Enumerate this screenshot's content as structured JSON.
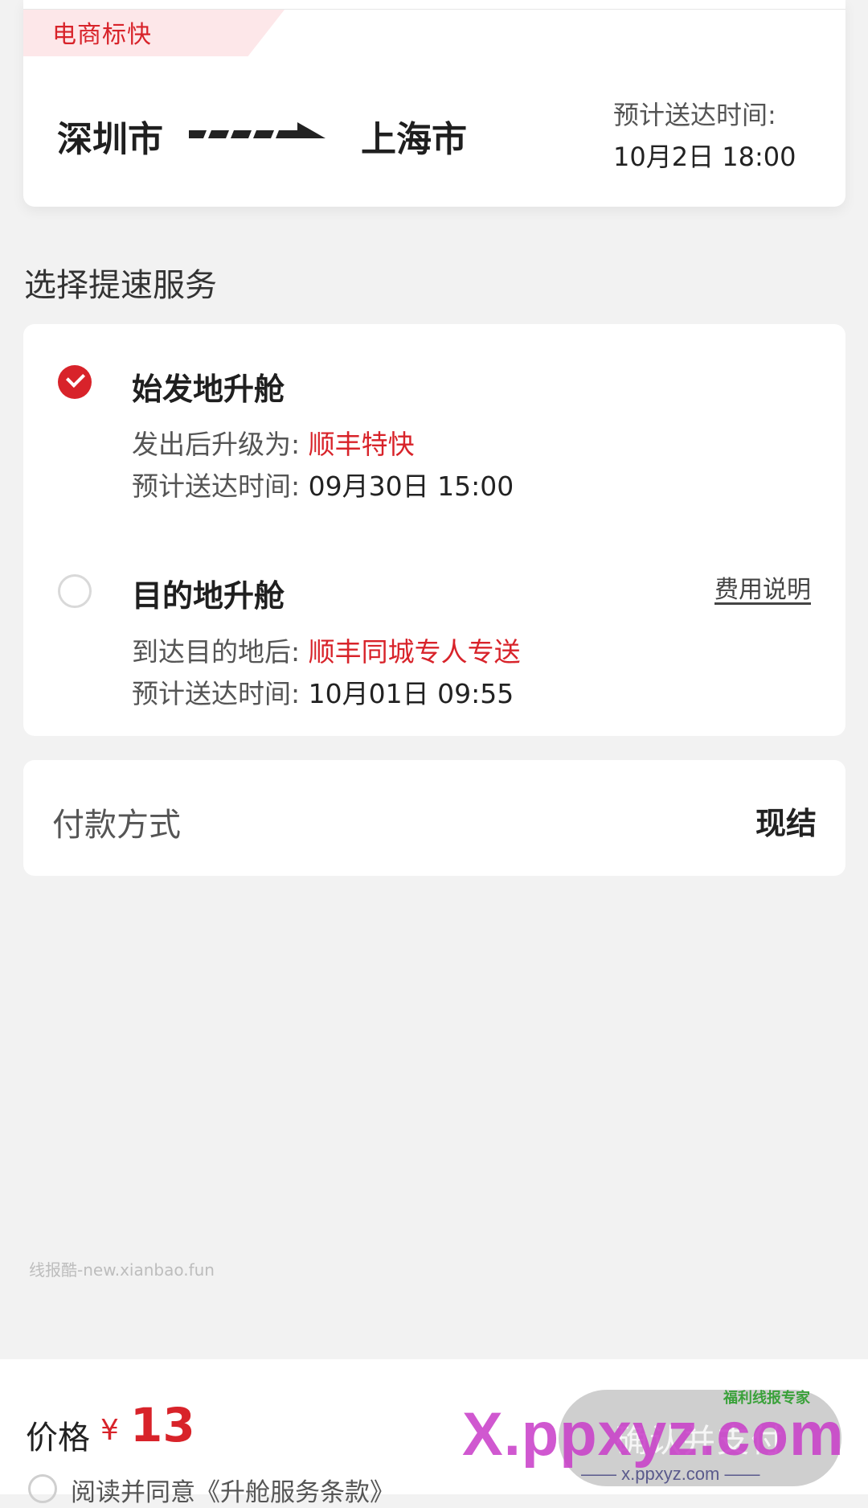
{
  "route": {
    "service_tag": "电商标快",
    "origin": "深圳市",
    "destination": "上海市",
    "eta_label": "预计送达时间:",
    "eta_value": "10月2日 18:00"
  },
  "section_title": "选择提速服务",
  "options": [
    {
      "title": "始发地升舱",
      "selected": true,
      "row1_label": "发出后升级为:",
      "row1_value": "顺丰特快",
      "row2_label": "预计送达时间:",
      "row2_value": "09月30日 15:00"
    },
    {
      "title": "目的地升舱",
      "selected": false,
      "link": "费用说明",
      "row1_label": "到达目的地后:",
      "row1_value": "顺丰同城专人专送",
      "row2_label": "预计送达时间:",
      "row2_value": "10月01日 09:55"
    }
  ],
  "payment": {
    "label": "付款方式",
    "value": "现结"
  },
  "watermark_text": "线报酷-new.xianbao.fun",
  "footer": {
    "price_label": "价格",
    "currency": "¥",
    "price": "13",
    "agreement_text": "阅读并同意《升舱服务条款》",
    "confirm_label": "确认并支付"
  },
  "site_watermark": {
    "brand": "X.ppxyz.com",
    "url": "—— x.ppxyz.com ——",
    "badge": "福利线报专家"
  },
  "colors": {
    "accent": "#d8232a",
    "tag_bg": "#fde7e9",
    "page_bg": "#f2f2f2"
  }
}
